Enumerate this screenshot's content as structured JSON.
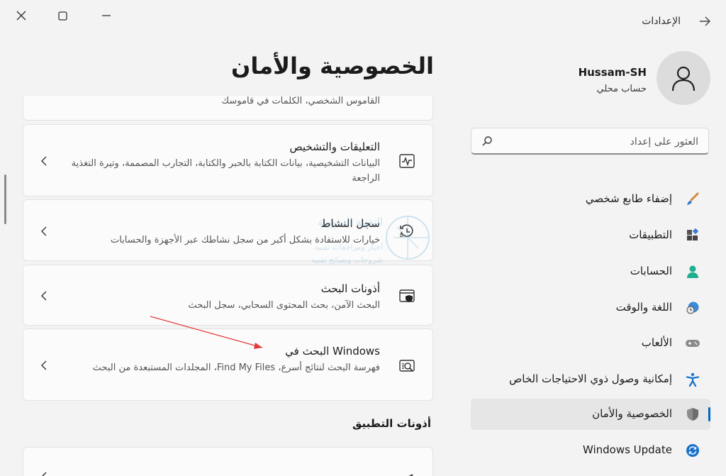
{
  "window": {
    "title": "الإعدادات",
    "controls": {
      "close": "×",
      "maximize": "□",
      "minimize": "—"
    }
  },
  "user": {
    "name": "Hussam-SH",
    "account_type": "حساب محلي"
  },
  "search": {
    "placeholder": "العثور على إعداد"
  },
  "sidebar": {
    "items": [
      {
        "label": "إضفاء طابع شخصي",
        "icon": "brush-icon",
        "active": false
      },
      {
        "label": "التطبيقات",
        "icon": "apps-icon",
        "active": false
      },
      {
        "label": "الحسابات",
        "icon": "person-icon",
        "active": false
      },
      {
        "label": "اللغة والوقت",
        "icon": "globe-clock-icon",
        "active": false
      },
      {
        "label": "الألعاب",
        "icon": "gamepad-icon",
        "active": false
      },
      {
        "label": "إمكانية وصول ذوي الاحتياجات الخاص",
        "icon": "accessibility-icon",
        "active": false
      },
      {
        "label": "الخصوصية والأمان",
        "icon": "shield-icon",
        "active": true
      },
      {
        "label": "Windows Update",
        "icon": "update-icon",
        "active": false
      }
    ]
  },
  "page": {
    "title": "الخصوصية والأمان"
  },
  "cards": {
    "partial": {
      "desc": "القاموس الشخصي، الكلمات في قاموسك"
    },
    "diagnostics": {
      "title": "التعليقات والتشخيص",
      "desc": "البيانات التشخيصية، بيانات الكتابة بالحبر والكتابة، التجارب المصممة، وتيرة التغذية الراجعة"
    },
    "activity": {
      "title": "سجل النشاط",
      "desc": "خيارات للاستفادة بشكل أكبر من سجل نشاطك عبر الأجهزة والحسابات"
    },
    "search_perms": {
      "title": "أذونات البحث",
      "desc": "البحث الآمن، بحث المحتوى السحابي، سجل البحث"
    },
    "windows_search": {
      "title": "البحث في Windows",
      "desc": "فهرسة البحث لنتائج أسرع، Find My Files، المجلدات المستبعدة من البحث"
    }
  },
  "sections": {
    "app_permissions": "أذونات التطبيق"
  },
  "watermark": {
    "line1": "التقنية السورية",
    "line2": "أخبار ومراجعات تقنية",
    "line3": "شروحات ونصائح تقنية"
  },
  "colors": {
    "accent": "#0067c0",
    "arrow": "#e53935",
    "background": "#f3f3f3"
  }
}
